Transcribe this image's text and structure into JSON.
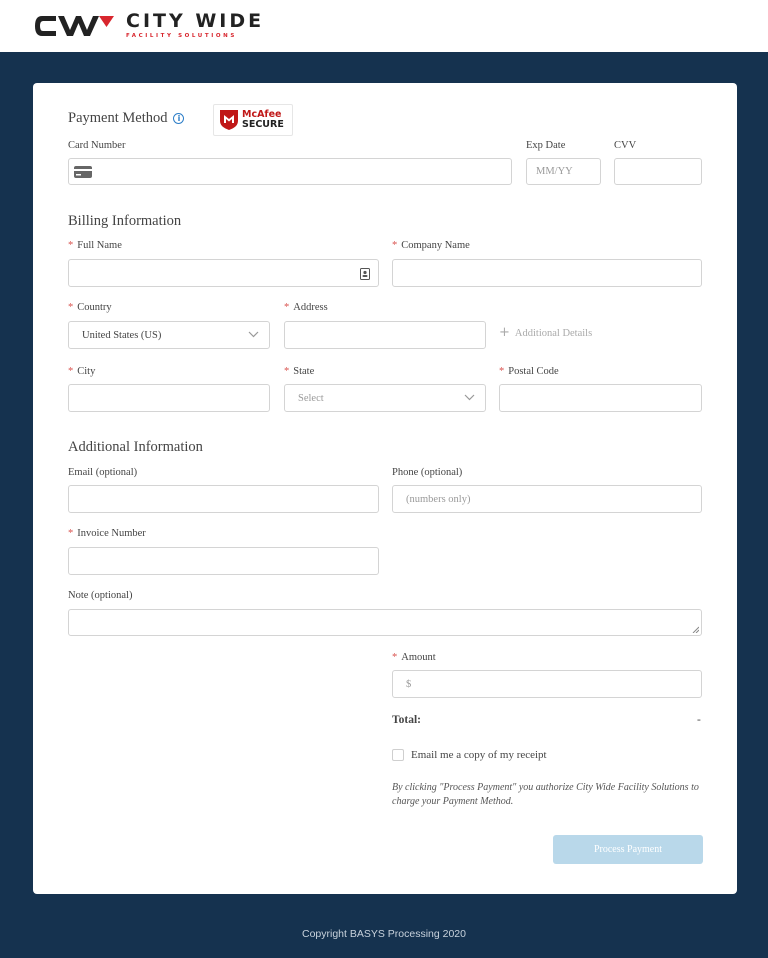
{
  "brand": {
    "title": "CITY WIDE",
    "subtitle": "FACILITY SOLUTIONS",
    "colors": {
      "red": "#d8262e",
      "dark": "#222222",
      "background": "#15324f",
      "button": "#b9d8ea"
    }
  },
  "payment": {
    "title": "Payment Method",
    "mcafee_brand": "McAfee",
    "mcafee_secure": "SECURE",
    "card_label": "Card Number",
    "exp_label": "Exp Date",
    "exp_placeholder": "MM/YY",
    "cvv_label": "CVV"
  },
  "billing": {
    "title": "Billing Information",
    "full_name_label": "Full Name",
    "company_label": "Company Name",
    "country_label": "Country",
    "country_value": "United States (US)",
    "address_label": "Address",
    "additional_details": "Additional Details",
    "city_label": "City",
    "state_label": "State",
    "state_placeholder": "Select",
    "postal_label": "Postal Code"
  },
  "additional": {
    "title": "Additional Information",
    "email_label": "Email (optional)",
    "phone_label": "Phone (optional)",
    "phone_placeholder": "(numbers only)",
    "invoice_label": "Invoice Number",
    "note_label": "Note (optional)",
    "amount_label": "Amount",
    "amount_placeholder": "$",
    "total_label": "Total:",
    "total_value": "-",
    "receipt_label": "Email me a copy of my receipt",
    "terms": "By clicking \"Process Payment\" you authorize City Wide Facility Solutions to charge your Payment Method.",
    "submit_label": "Process Payment"
  },
  "required_marker": "*",
  "footer": "Copyright BASYS Processing 2020"
}
